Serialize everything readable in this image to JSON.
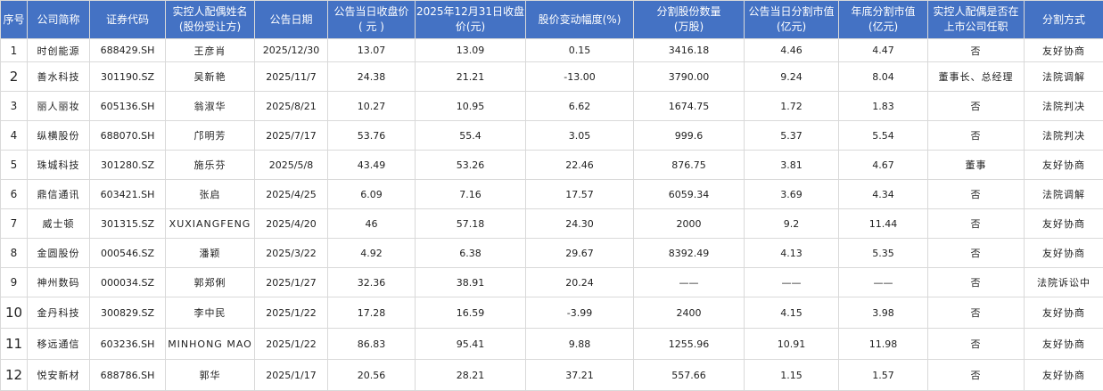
{
  "headers": [
    {
      "line1": "序号",
      "line2": ""
    },
    {
      "line1": "公司简称",
      "line2": ""
    },
    {
      "line1": "证券代码",
      "line2": ""
    },
    {
      "line1": "实控人配偶姓名",
      "line2": "(股份受让方)"
    },
    {
      "line1": "公告日期",
      "line2": ""
    },
    {
      "line1": "公告当日收盘价",
      "line2": "( 元 )"
    },
    {
      "line1": "2025年12月31日收盘",
      "line2": "价(元)"
    },
    {
      "line1": "股价变动幅度(%)",
      "line2": ""
    },
    {
      "line1": "分割股份数量",
      "line2": "(万股)"
    },
    {
      "line1": "公告当日分割市值",
      "line2": "(亿元)"
    },
    {
      "line1": "年底分割市值",
      "line2": "(亿元)"
    },
    {
      "line1": "实控人配偶是否在",
      "line2": "上市公司任职"
    },
    {
      "line1": "分割方式",
      "line2": ""
    }
  ],
  "rows": [
    [
      "1",
      "时创能源",
      "688429.SH",
      "王彦肖",
      "2025/12/30",
      "13.07",
      "13.09",
      "0.15",
      "3416.18",
      "4.46",
      "4.47",
      "否",
      "友好协商"
    ],
    [
      "2",
      "善水科技",
      "301190.SZ",
      "吴新艳",
      "2025/11/7",
      "24.38",
      "21.21",
      "-13.00",
      "3790.00",
      "9.24",
      "8.04",
      "董事长、总经理",
      "法院调解"
    ],
    [
      "3",
      "丽人丽妆",
      "605136.SH",
      "翁淑华",
      "2025/8/21",
      "10.27",
      "10.95",
      "6.62",
      "1674.75",
      "1.72",
      "1.83",
      "否",
      "法院判决"
    ],
    [
      "4",
      "纵横股份",
      "688070.SH",
      "邝明芳",
      "2025/7/17",
      "53.76",
      "55.4",
      "3.05",
      "999.6",
      "5.37",
      "5.54",
      "否",
      "法院判决"
    ],
    [
      "5",
      "珠城科技",
      "301280.SZ",
      "施乐芬",
      "2025/5/8",
      "43.49",
      "53.26",
      "22.46",
      "876.75",
      "3.81",
      "4.67",
      "董事",
      "友好协商"
    ],
    [
      "6",
      "鼎信通讯",
      "603421.SH",
      "张启",
      "2025/4/25",
      "6.09",
      "7.16",
      "17.57",
      "6059.34",
      "3.69",
      "4.34",
      "否",
      "法院调解"
    ],
    [
      "7",
      "威士顿",
      "301315.SZ",
      "XUXIANGFENG",
      "2025/4/20",
      "46",
      "57.18",
      "24.30",
      "2000",
      "9.2",
      "11.44",
      "否",
      "友好协商"
    ],
    [
      "8",
      "金圆股份",
      "000546.SZ",
      "潘颖",
      "2025/3/22",
      "4.92",
      "6.38",
      "29.67",
      "8392.49",
      "4.13",
      "5.35",
      "否",
      "友好协商"
    ],
    [
      "9",
      "神州数码",
      "000034.SZ",
      "郭郑俐",
      "2025/1/27",
      "32.36",
      "38.91",
      "20.24",
      "——",
      "——",
      "——",
      "否",
      "法院诉讼中"
    ],
    [
      "10",
      "金丹科技",
      "300829.SZ",
      "李中民",
      "2025/1/22",
      "17.28",
      "16.59",
      "-3.99",
      "2400",
      "4.15",
      "3.98",
      "否",
      "友好协商"
    ],
    [
      "11",
      "移远通信",
      "603236.SH",
      "MINHONG MAO",
      "2025/1/22",
      "86.83",
      "95.41",
      "9.88",
      "1255.96",
      "10.91",
      "11.98",
      "否",
      "友好协商"
    ],
    [
      "12",
      "悦安新材",
      "688786.SH",
      "郭华",
      "2025/1/17",
      "20.56",
      "28.21",
      "37.21",
      "557.66",
      "1.15",
      "1.57",
      "否",
      "友好协商"
    ]
  ]
}
